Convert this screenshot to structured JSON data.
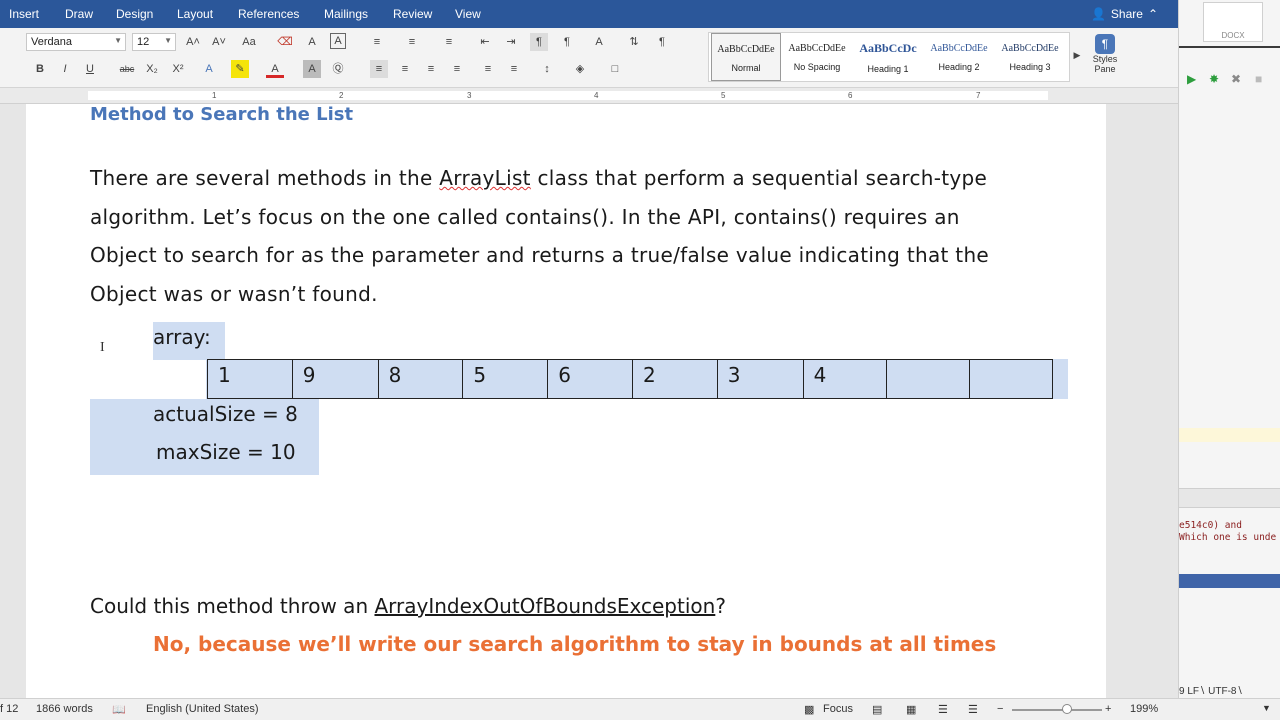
{
  "tabs": [
    "Insert",
    "Draw",
    "Design",
    "Layout",
    "References",
    "Mailings",
    "Review",
    "View"
  ],
  "share_label": "Share",
  "font_name": "Verdana",
  "font_size": "12",
  "styles": [
    {
      "preview": "AaBbCcDdEe",
      "name": "Normal"
    },
    {
      "preview": "AaBbCcDdEe",
      "name": "No Spacing"
    },
    {
      "preview": "AaBbCcDc",
      "name": "Heading 1"
    },
    {
      "preview": "AaBbCcDdEe",
      "name": "Heading 2"
    },
    {
      "preview": "AaBbCcDdEe",
      "name": "Heading 3"
    }
  ],
  "styles_pane_label": "Styles\nPane",
  "ruler_numbers": [
    "1",
    "2",
    "3",
    "4",
    "5",
    "6",
    "7"
  ],
  "document": {
    "heading": "Method to Search the List",
    "paragraph": [
      {
        "before": "There are several methods in the ",
        "flagged": "ArrayList",
        "after": " class that perform a sequential search-type"
      },
      {
        "text": "algorithm.  Let’s focus on the one called contains().  In the API, contains() requires an"
      },
      {
        "text": "Object to search for as the parameter and returns a true/false value indicating that the"
      },
      {
        "text": "Object was or wasn’t found."
      }
    ],
    "array_label": "array:",
    "array_cells": [
      "1",
      "9",
      "8",
      "5",
      "6",
      "2",
      "3",
      "4",
      "",
      ""
    ],
    "actual_size": "actualSize = 8",
    "max_size": "maxSize = 10",
    "question_prefix": "Could this method throw an ",
    "question_link": "ArrayIndexOutOfBoundsException",
    "question_suffix": "?",
    "answer": "No, because we’ll write our search algorithm to stay in bounds at all times"
  },
  "side_panel": {
    "thumb_label": "DOCX",
    "console_text": "e514c0) and\nWhich one is unde",
    "footer_text": "9  LF∖ UTF-8∖"
  },
  "status": {
    "page": "f 12",
    "words": "1866 words",
    "language": "English (United States)",
    "focus": "Focus",
    "zoom": "199%"
  },
  "colors": {
    "tab_bar": "#2b579a",
    "heading": "#4a76b8",
    "answer": "#ea7035",
    "selection": "#cfddf2"
  }
}
